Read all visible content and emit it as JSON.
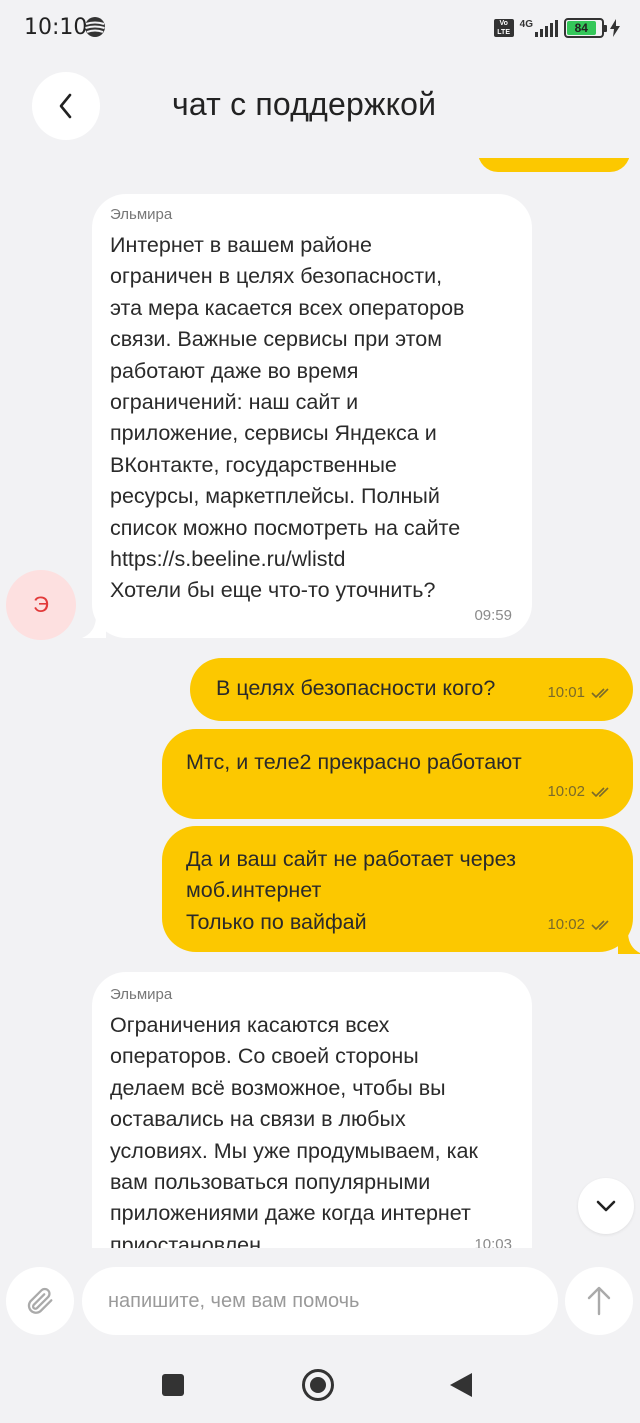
{
  "status_bar": {
    "time": "10:10",
    "volte_top": "Vo",
    "volte_bottom": "LTE",
    "network": "4G",
    "battery": "84"
  },
  "header": {
    "title": "чат с поддержкой",
    "back_icon": "chevron-left-icon"
  },
  "chat": {
    "agent_initial": "Э",
    "messages": [
      {
        "direction": "in",
        "sender": "Эльмира",
        "text": "Интернет в вашем районе\nограничен в целях безопасности,\nэта мера касается всех операторов\nсвязи. Важные  сервисы при этом\nработают даже во время\nограничений: наш сайт и\nприложение, сервисы Яндекса и\nВКонтакте, государственные\nресурсы, маркетплейсы. Полный\nсписок можно посмотреть на сайте\nhttps://s.beeline.ru/wlistd\nХотели бы еще что-то уточнить?",
        "time": "09:59"
      },
      {
        "direction": "out",
        "text": "В целях безопасности кого?",
        "time": "10:01"
      },
      {
        "direction": "out",
        "text": "Мтс, и теле2 прекрасно работают",
        "time": "10:02"
      },
      {
        "direction": "out",
        "text": "Да и ваш сайт не работает через\nмоб.интернет\nТолько по вайфай",
        "time": "10:02"
      },
      {
        "direction": "in",
        "sender": "Эльмира",
        "text": "Ограничения касаются всех\nоператоров. Со своей стороны\nделаем всё возможное, чтобы вы\nоставались на связи в любых\nусловиях. Мы уже продумываем, как\nвам пользоваться популярными\nприложениями даже когда интернет\nприостановлен",
        "time": "10:03"
      }
    ]
  },
  "composer": {
    "placeholder": "напишите, чем вам помочь",
    "attach_icon": "paperclip-icon",
    "send_icon": "arrow-up-icon"
  },
  "colors": {
    "background": "#f2f2f4",
    "outgoing_bubble": "#fcc800",
    "incoming_bubble": "#ffffff",
    "avatar_bg": "#fde0e0",
    "avatar_text": "#e23a3a"
  }
}
